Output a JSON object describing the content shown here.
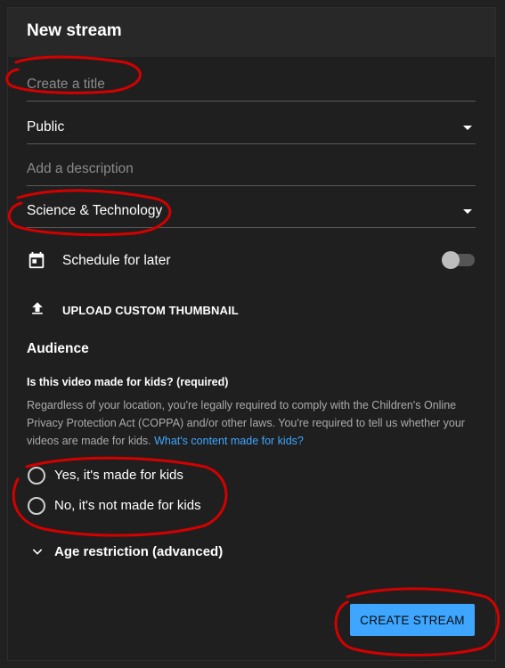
{
  "dialog": {
    "title": "New stream"
  },
  "form": {
    "title_placeholder": "Create a title",
    "visibility": "Public",
    "description_placeholder": "Add a description",
    "category": "Science & Technology",
    "schedule_label": "Schedule for later",
    "upload_thumbnail_label": "UPLOAD CUSTOM THUMBNAIL"
  },
  "audience": {
    "heading": "Audience",
    "question": "Is this video made for kids? (required)",
    "body": "Regardless of your location, you're legally required to comply with the Children's Online Privacy Protection Act (COPPA) and/or other laws. You're required to tell us whether your videos are made for kids. ",
    "link": "What's content made for kids?",
    "options": [
      "Yes, it's made for kids",
      "No, it's not made for kids"
    ]
  },
  "age_restriction_label": "Age restriction (advanced)",
  "create_button_label": "CREATE STREAM",
  "colors": {
    "accent": "#3ea6ff",
    "annotation": "#d40000"
  }
}
